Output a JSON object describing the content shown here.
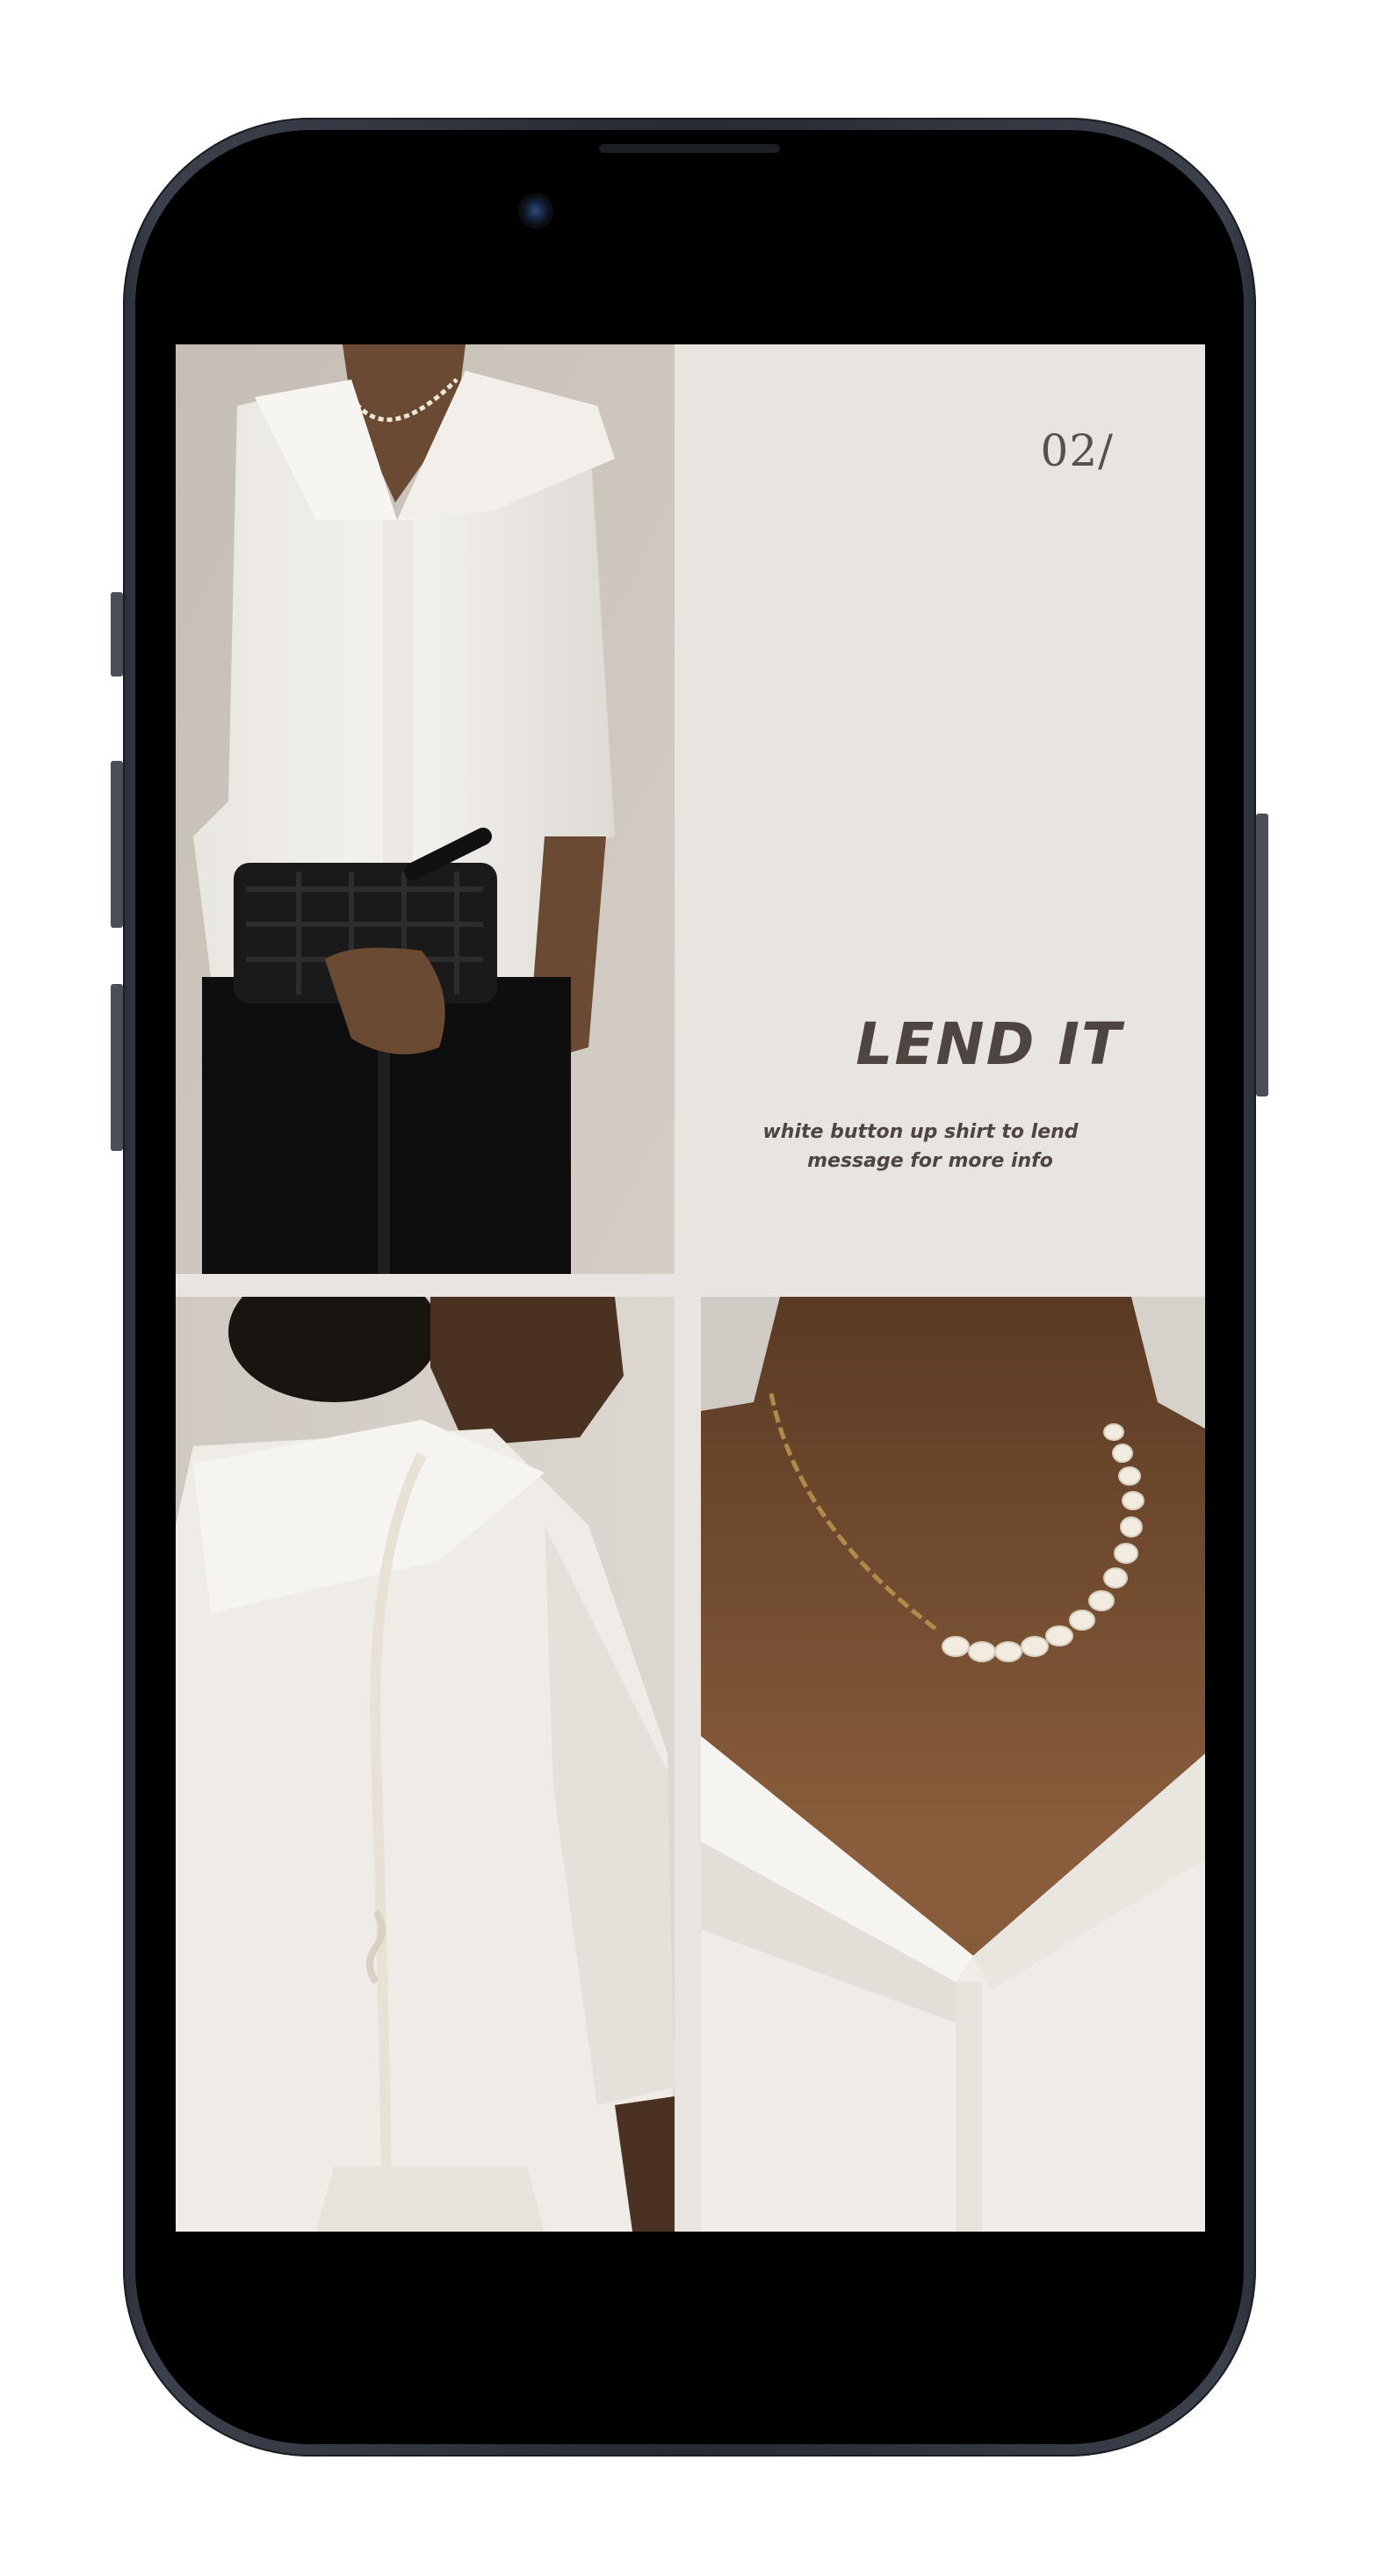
{
  "slide": {
    "number": "02/",
    "headline": "LEND IT",
    "caption_line1": "white button up shirt to lend",
    "caption_line2": "message for more info"
  },
  "colors": {
    "background": "#e8e5e0",
    "text": "#4e4540",
    "phone_frame": "#2a2f38"
  }
}
